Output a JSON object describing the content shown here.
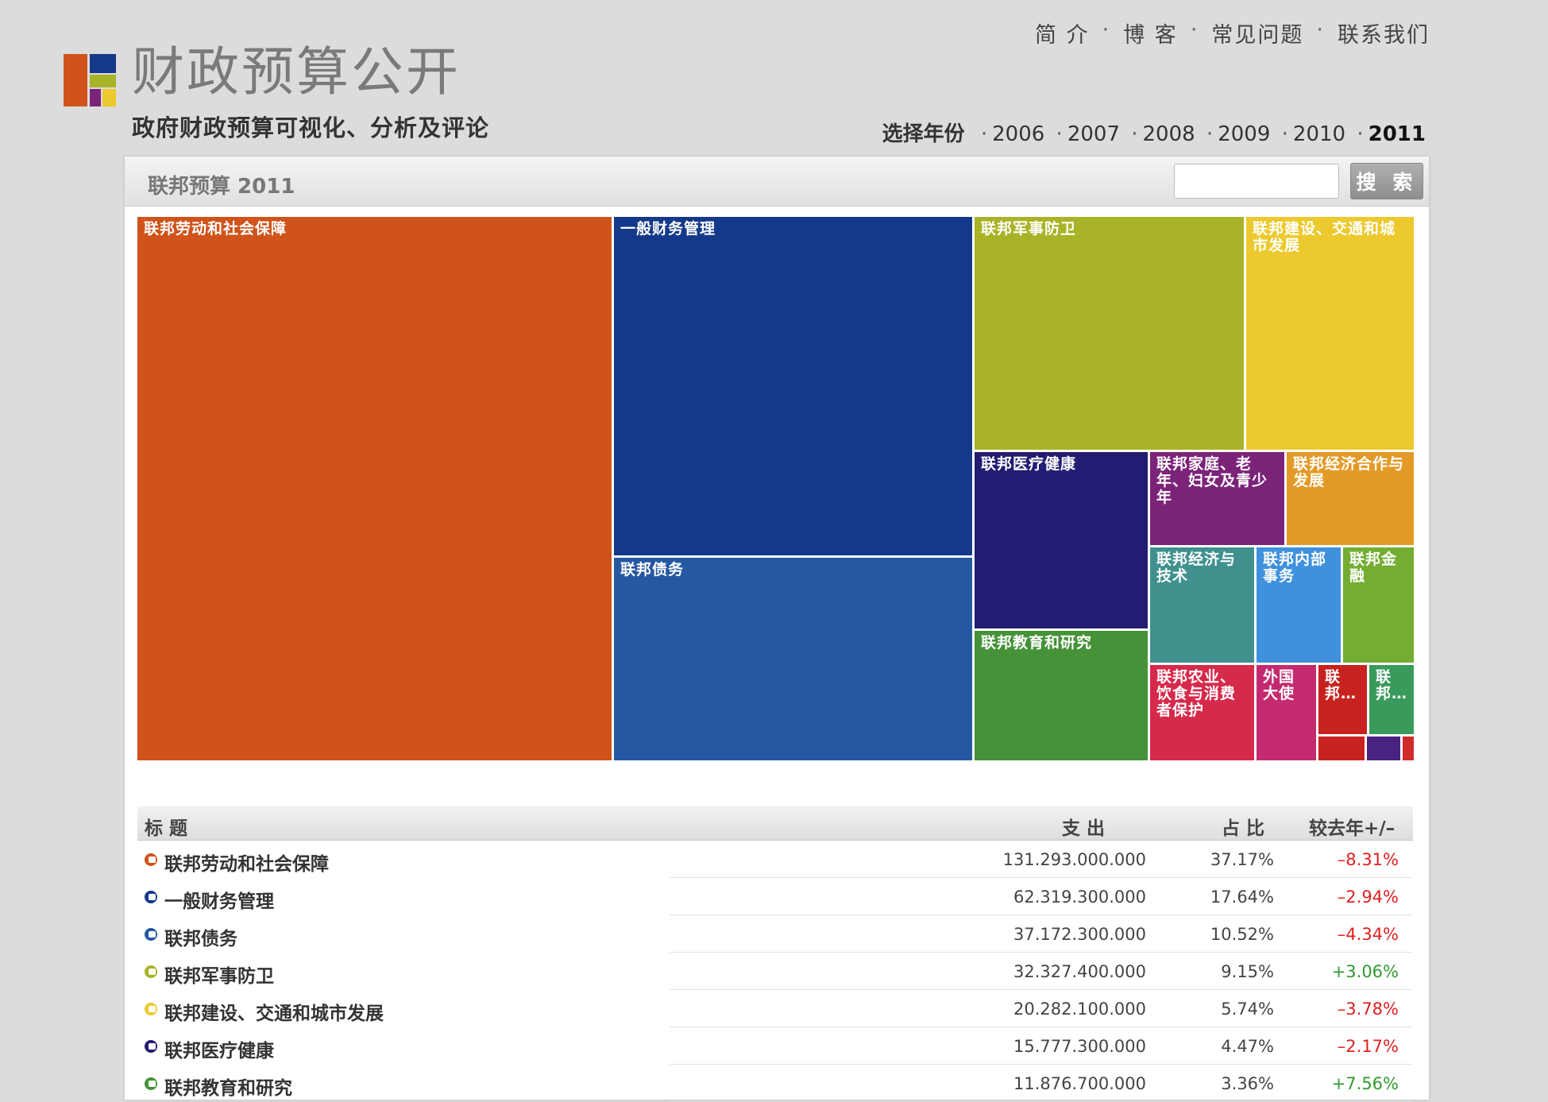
{
  "nav": {
    "items": [
      "简 介",
      "博 客",
      "常见问题",
      "联系我们"
    ],
    "separator": "·"
  },
  "site": {
    "title": "财政预算公开",
    "subtitle": "政府财政预算可视化、分析及评论"
  },
  "years": {
    "label": "选择年份",
    "items": [
      "2006",
      "2007",
      "2008",
      "2009",
      "2010",
      "2011"
    ],
    "selected": "2011"
  },
  "panel": {
    "title": "联邦预算 2011",
    "search_value": "",
    "search_label": "搜 索"
  },
  "treemap_tiles": [
    {
      "label": "联邦劳动和社会保障",
      "color": "#cf531b"
    },
    {
      "label": "一般财务管理",
      "color": "#15398a"
    },
    {
      "label": "联邦债务",
      "color": "#2558a2"
    },
    {
      "label": "联邦军事防卫",
      "color": "#a8b327"
    },
    {
      "label": "联邦建设、交通和城市发展",
      "color": "#ecc92d"
    },
    {
      "label": "联邦医疗健康",
      "color": "#221c72"
    },
    {
      "label": "联邦家庭、老年、妇女及青少年",
      "color": "#7b2379"
    },
    {
      "label": "联邦经济合作与发展",
      "color": "#e39a27"
    },
    {
      "label": "联邦教育和研究",
      "color": "#459238"
    },
    {
      "label": "联邦经济与技术",
      "color": "#40918e"
    },
    {
      "label": "联邦内部事务",
      "color": "#3f91dd"
    },
    {
      "label": "联邦金融",
      "color": "#74ad32"
    },
    {
      "label": "联邦农业、饮食与消费者保护",
      "color": "#d62a4b"
    },
    {
      "label": "外国大使",
      "color": "#c42a6f"
    },
    {
      "label": "联邦…",
      "color": "#c7221f"
    },
    {
      "label": "联邦…",
      "color": "#3a9a5b"
    },
    {
      "label": "",
      "color": "#c7221f"
    },
    {
      "label": "",
      "color": "#4a2280"
    },
    {
      "label": "",
      "color": "#d12a2a"
    }
  ],
  "table": {
    "headers": {
      "title": "标 题",
      "amount": "支 出",
      "share": "占 比",
      "change": "较去年+/–"
    },
    "rows": [
      {
        "title": "联邦劳动和社会保障",
        "amount": "131.293.000.000",
        "share": "37.17%",
        "change": "–8.31%",
        "color": "#cf531b",
        "change_color": "#e02020"
      },
      {
        "title": "一般财务管理",
        "amount": "62.319.300.000",
        "share": "17.64%",
        "change": "–2.94%",
        "color": "#15398a",
        "change_color": "#e02020"
      },
      {
        "title": "联邦债务",
        "amount": "37.172.300.000",
        "share": "10.52%",
        "change": "–4.34%",
        "color": "#2558a2",
        "change_color": "#e02020"
      },
      {
        "title": "联邦军事防卫",
        "amount": "32.327.400.000",
        "share": "9.15%",
        "change": "+3.06%",
        "color": "#a8b327",
        "change_color": "#2f9a2f"
      },
      {
        "title": "联邦建设、交通和城市发展",
        "amount": "20.282.100.000",
        "share": "5.74%",
        "change": "–3.78%",
        "color": "#ecc92d",
        "change_color": "#e02020"
      },
      {
        "title": "联邦医疗健康",
        "amount": "15.777.300.000",
        "share": "4.47%",
        "change": "–2.17%",
        "color": "#221c72",
        "change_color": "#e02020"
      },
      {
        "title": "联邦教育和研究",
        "amount": "11.876.700.000",
        "share": "3.36%",
        "change": "+7.56%",
        "color": "#459238",
        "change_color": "#2f9a2f"
      }
    ]
  },
  "logo_colors": [
    "#cf531b",
    "#15398a",
    "#a8b327",
    "#7b2379",
    "#ecc92d"
  ]
}
